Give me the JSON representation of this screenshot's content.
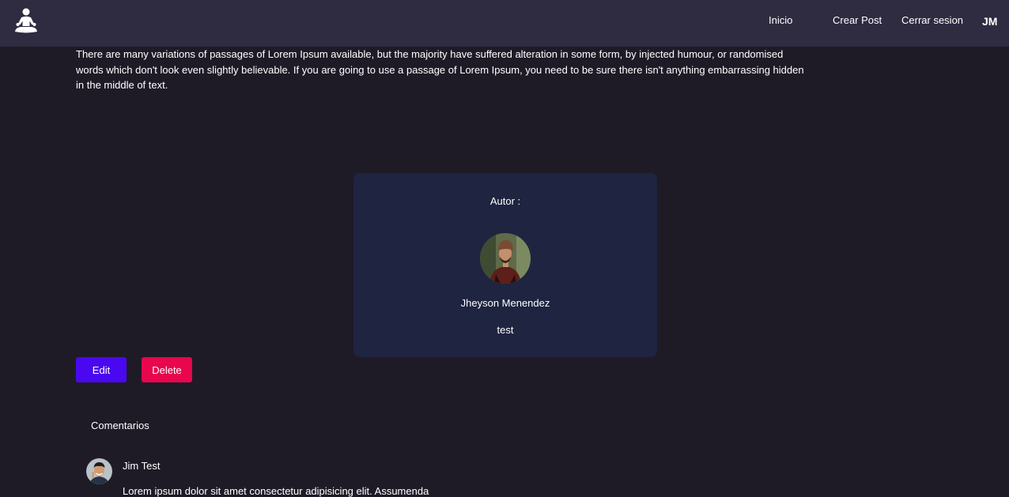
{
  "navbar": {
    "logo_icon": "meditation-person-icon",
    "links": {
      "home": "Inicio",
      "create_post": "Crear Post",
      "logout": "Cerrar sesion"
    },
    "user_initials": "JM"
  },
  "post": {
    "body": "There are many variations of passages of Lorem Ipsum available, but the majority have suffered alteration in some form, by injected humour, or randomised words which don't look even slightly believable.  If you are going to use a passage of Lorem Ipsum, you need to be sure there isn't anything embarrassing hidden in the middle of text."
  },
  "author": {
    "label": "Autor :",
    "name": "Jheyson Menendez",
    "bio": "test"
  },
  "actions": {
    "edit_label": "Edit",
    "delete_label": "Delete"
  },
  "comments": {
    "title": "Comentarios",
    "items": [
      {
        "author": "Jim Test",
        "text": "Lorem ipsum dolor sit amet consectetur adipisicing elit. Assumenda"
      }
    ]
  },
  "colors": {
    "navbar_bg": "#2f2b40",
    "page_bg": "#1e1b27",
    "card_bg": "#1f2440",
    "edit_button": "#4a08f0",
    "delete_button": "#e8064d"
  }
}
